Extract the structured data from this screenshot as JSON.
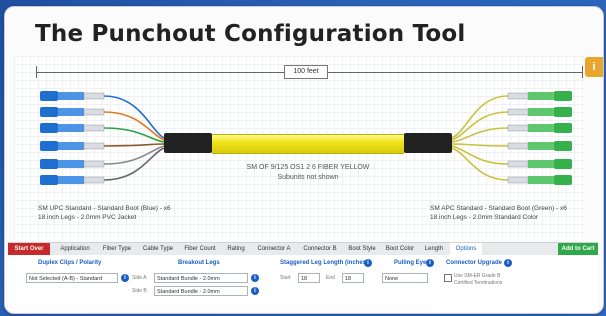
{
  "title": "The Punchout Configuration Tool",
  "corner_badge": "i",
  "length_label": "100 feet",
  "cable_label_line1": "SM OF 9/125 OS1 2 6 FIBER YELLOW",
  "cable_label_line2": "Subunits not shown",
  "left_desc_line1": "SM UPC Standard - Standard Boot (Blue) - x6",
  "left_desc_line2": "18 inch Legs - 2.0mm PVC Jacket",
  "right_desc_line1": "SM APC Standard - Standard Boot (Green) - x6",
  "right_desc_line2": "18 inch Legs - 2.0mm Standard Color",
  "tabs": {
    "start": "Start Over",
    "items": [
      "Application",
      "Fiber Type",
      "Cable Type",
      "Fiber Count",
      "Rating",
      "Connector A",
      "Connector B",
      "Boot Style",
      "Boot Color",
      "Length",
      "Options"
    ],
    "end": "Add to Cart"
  },
  "options": {
    "duplex_label": "Duplex Clips / Polarity",
    "duplex_value": "Not Selected (A-B) - Standard",
    "breakout_label": "Breakout Legs",
    "side_a": "Side A",
    "side_b": "Side B",
    "breakout_a_value": "Standard Bundle - 2.0mm",
    "breakout_b_value": "Standard Bundle - 2.0mm",
    "staggered_label": "Staggered Leg Length (inches)",
    "start_label": "Start",
    "end_label": "End",
    "stagger_start": "18",
    "stagger_end": "18",
    "pulling_label": "Pulling Eye",
    "pulling_value": "None",
    "connector_label": "Connector Upgrade",
    "connector_option_line1": "Use SM-ER Grade B",
    "connector_option_line2": "Certified Terminations"
  },
  "colors": {
    "blue_connector": "#1f6fd1",
    "green_connector": "#35b04a",
    "cable_yellow": "#f0e41c",
    "start_tab": "#c72a2a",
    "end_tab": "#2fa84a",
    "accent": "#1a5fc4"
  }
}
